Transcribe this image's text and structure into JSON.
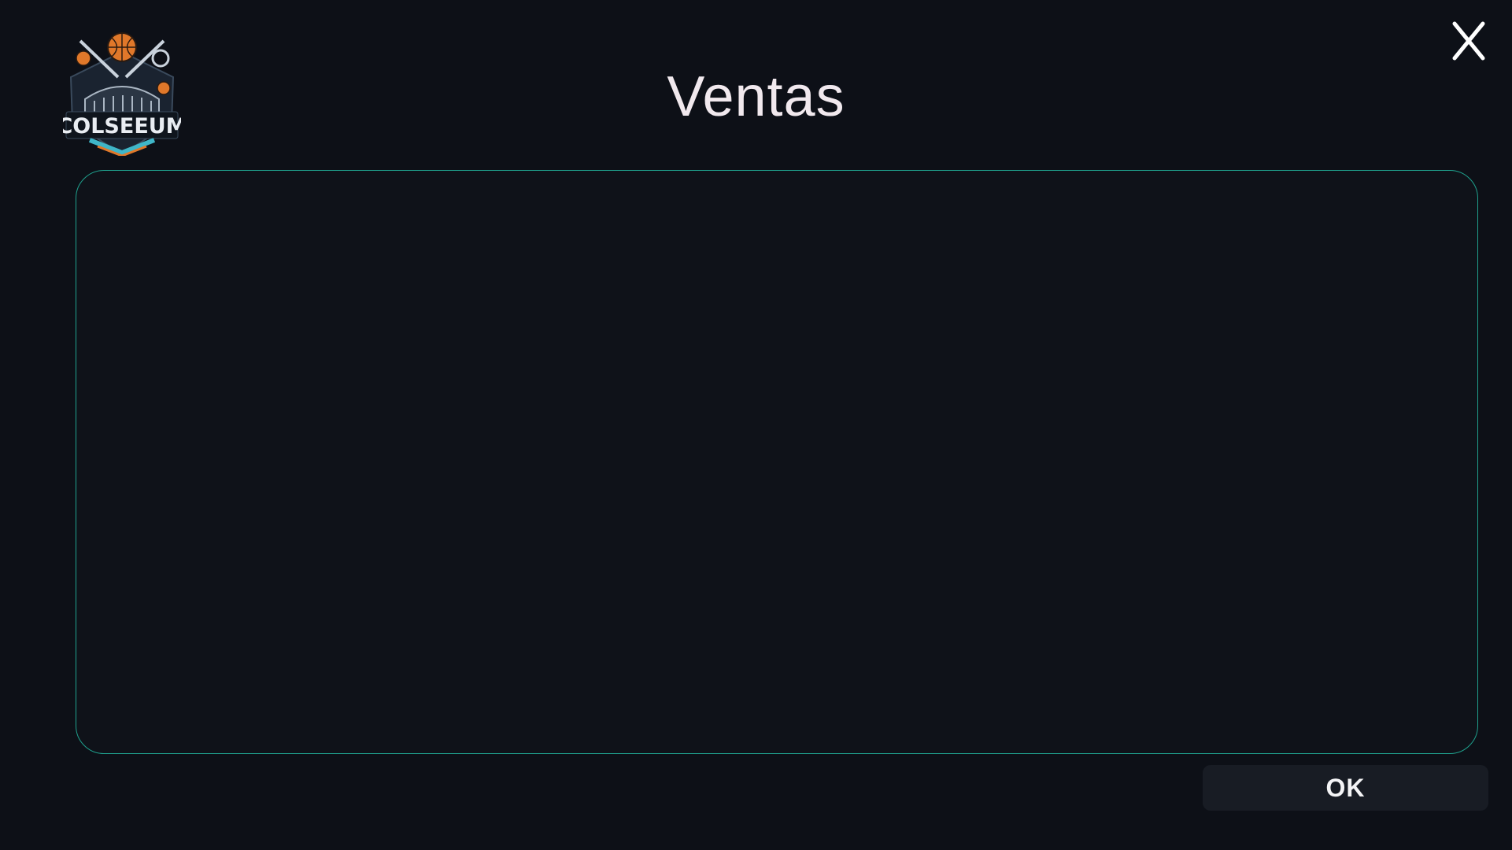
{
  "logo": {
    "text": "COLSEEUM",
    "colors": {
      "ball": "#e0782a",
      "accent": "#3fb6c8",
      "outline": "#e9edf2"
    }
  },
  "header": {
    "title": "Ventas",
    "close_icon": "close-icon"
  },
  "dialog": {
    "ok_label": "OK"
  },
  "theme": {
    "background": "#0d1017",
    "panel_border": "#1fa08d",
    "button_bg": "#181c24",
    "title_color": "#f1e9ee"
  }
}
